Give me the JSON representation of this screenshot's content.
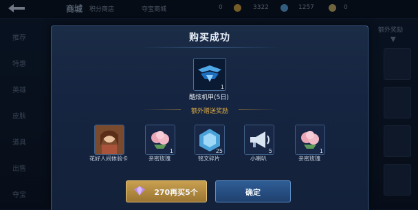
{
  "topbar": {
    "title": "商城",
    "subtitle": "积分商店",
    "center_label": "夺宝商城",
    "counter_1": "0",
    "gold": "3322",
    "diamond": "1257",
    "counter_4": "0"
  },
  "sidebar_left": [
    "推荐",
    "特惠",
    "英雄",
    "皮肤",
    "道具",
    "出售",
    "夺宝"
  ],
  "sidebar_right": {
    "title": "额外奖励",
    "arrow_symbol": "▼"
  },
  "modal": {
    "title": "购买成功",
    "main_item": {
      "name": "酷炫机甲(5日)",
      "count": "1",
      "icon": "mecha-skin-icon"
    },
    "bonus_title": "额外赠送奖励",
    "rewards": [
      {
        "name": "花好人间体验卡",
        "count": "",
        "icon": "hero-portrait-icon"
      },
      {
        "name": "亲密玫瑰",
        "count": "1",
        "icon": "rose-icon"
      },
      {
        "name": "铭文碎片",
        "count": "25",
        "icon": "inscription-shard-icon"
      },
      {
        "name": "小喇叭",
        "count": "5",
        "icon": "megaphone-icon"
      },
      {
        "name": "亲密玫瑰",
        "count": "1",
        "icon": "rose-icon"
      }
    ],
    "buy_button": "270再买5个",
    "confirm_button": "确定"
  },
  "colors": {
    "gold": "#d8a845",
    "modal_bg": "#152440",
    "accent": "#4c77aa"
  }
}
